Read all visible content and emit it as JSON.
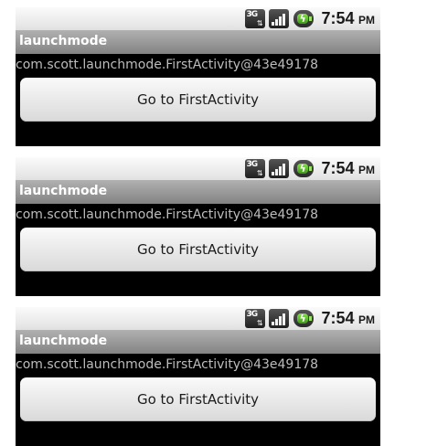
{
  "screens": [
    {
      "status": {
        "time": "7:54",
        "ampm": "PM",
        "network": "3G"
      },
      "title": "launchmode",
      "activity_text": "com.scott.launchmode.FirstActivity@43e49178",
      "button_label": "Go to FirstActivity"
    },
    {
      "status": {
        "time": "7:54",
        "ampm": "PM",
        "network": "3G"
      },
      "title": "launchmode",
      "activity_text": "com.scott.launchmode.FirstActivity@43e49178",
      "button_label": "Go to FirstActivity"
    },
    {
      "status": {
        "time": "7:54",
        "ampm": "PM",
        "network": "3G"
      },
      "title": "launchmode",
      "activity_text": "com.scott.launchmode.FirstActivity@43e49178",
      "button_label": "Go to FirstActivity"
    }
  ],
  "icons": [
    "network-3g-icon",
    "signal-strength-icon",
    "battery-charging-icon"
  ],
  "colors": {
    "titlebar": "#9a9a9a",
    "content_bg": "#000000",
    "activity_text": "#bdbdbd",
    "button_bg": "#e6e6e6"
  }
}
